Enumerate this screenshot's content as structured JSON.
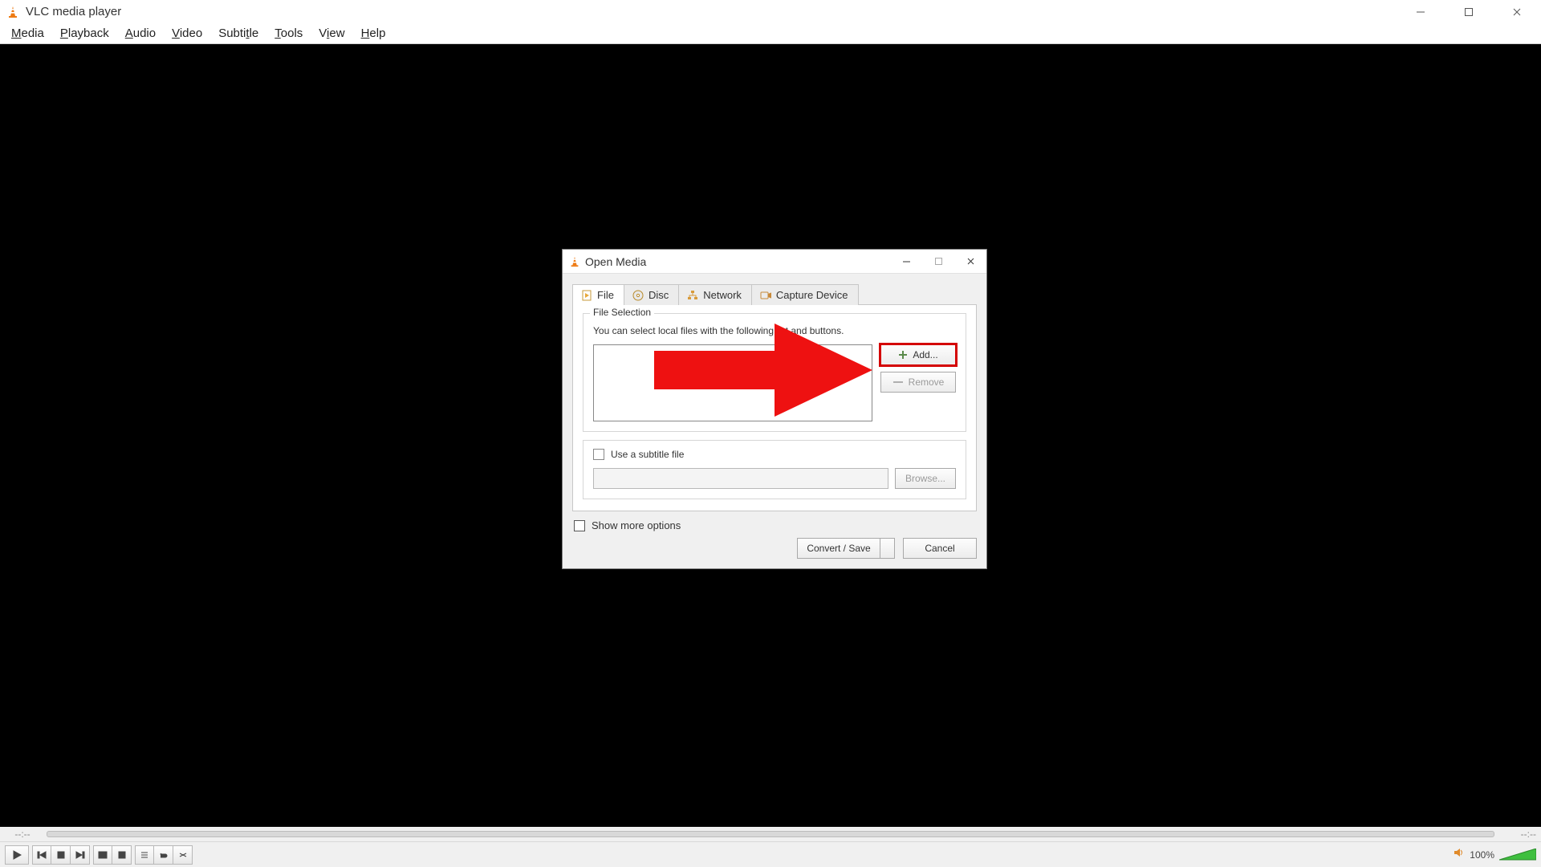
{
  "app": {
    "title": "VLC media player"
  },
  "menus": {
    "media": {
      "pre": "",
      "u": "M",
      "post": "edia"
    },
    "playback": {
      "pre": "",
      "u": "P",
      "post": "layback"
    },
    "audio": {
      "pre": "",
      "u": "A",
      "post": "udio"
    },
    "video": {
      "pre": "",
      "u": "V",
      "post": "ideo"
    },
    "subtitle": {
      "pre": "Subti",
      "u": "t",
      "post": "le"
    },
    "tools": {
      "pre": "",
      "u": "T",
      "post": "ools"
    },
    "view": {
      "pre": "V",
      "u": "i",
      "post": "ew"
    },
    "help": {
      "pre": "",
      "u": "H",
      "post": "elp"
    }
  },
  "seek": {
    "left": "--:--",
    "right": "--:--"
  },
  "volume": {
    "pct": "100%"
  },
  "dialog": {
    "title": "Open Media",
    "tabs": {
      "file": "File",
      "disc": "Disc",
      "network": "Network",
      "capture": "Capture Device"
    },
    "file_group": {
      "title": "File Selection",
      "desc": "You can select local files with the following list and buttons.",
      "add": "Add...",
      "remove": "Remove"
    },
    "subtitle": {
      "label": "Use a subtitle file",
      "browse": "Browse..."
    },
    "more": "Show more options",
    "convert": "Convert / Save",
    "cancel": "Cancel"
  }
}
